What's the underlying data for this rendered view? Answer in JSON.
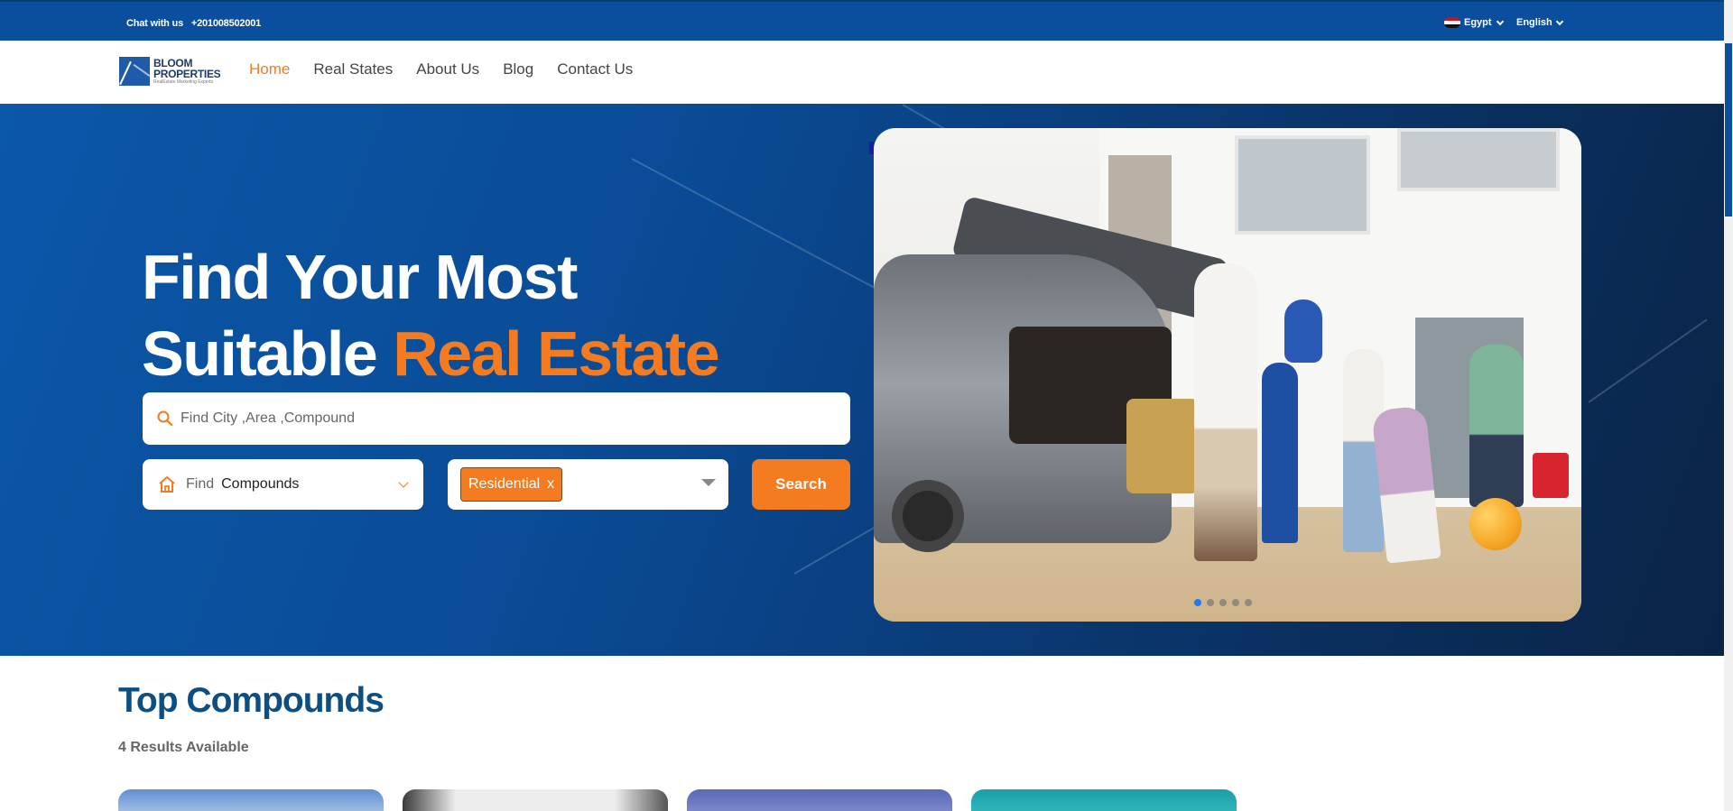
{
  "topbar": {
    "chat_label": "Chat with us",
    "phone": "+201008502001",
    "country": "Egypt",
    "language": "English"
  },
  "logo": {
    "line1": "BLOOM",
    "line2": "PROPERTIES",
    "tagline": "RealEstate Marketing Experts"
  },
  "nav": {
    "items": [
      {
        "label": "Home",
        "active": true
      },
      {
        "label": "Real States",
        "active": false
      },
      {
        "label": "About Us",
        "active": false
      },
      {
        "label": "Blog",
        "active": false
      },
      {
        "label": "Contact Us",
        "active": false
      }
    ]
  },
  "hero": {
    "headline_line1": "Find Your Most",
    "headline_line2_plain": "Suitable",
    "headline_line2_accent": "Real Estate",
    "search_placeholder": "Find City ,Area ,Compound",
    "find_label": "Find",
    "find_value": "Compounds",
    "type_chip": "Residential",
    "type_chip_remove": "x",
    "search_button": "Search",
    "carousel_slides": 5,
    "carousel_active": 1
  },
  "compounds": {
    "title": "Top Compounds",
    "results": "4 Results Available",
    "cards": 4
  },
  "colors": {
    "brand_blue": "#0a4f9e",
    "accent_orange": "#f47b20",
    "title_blue": "#0d4f82"
  }
}
